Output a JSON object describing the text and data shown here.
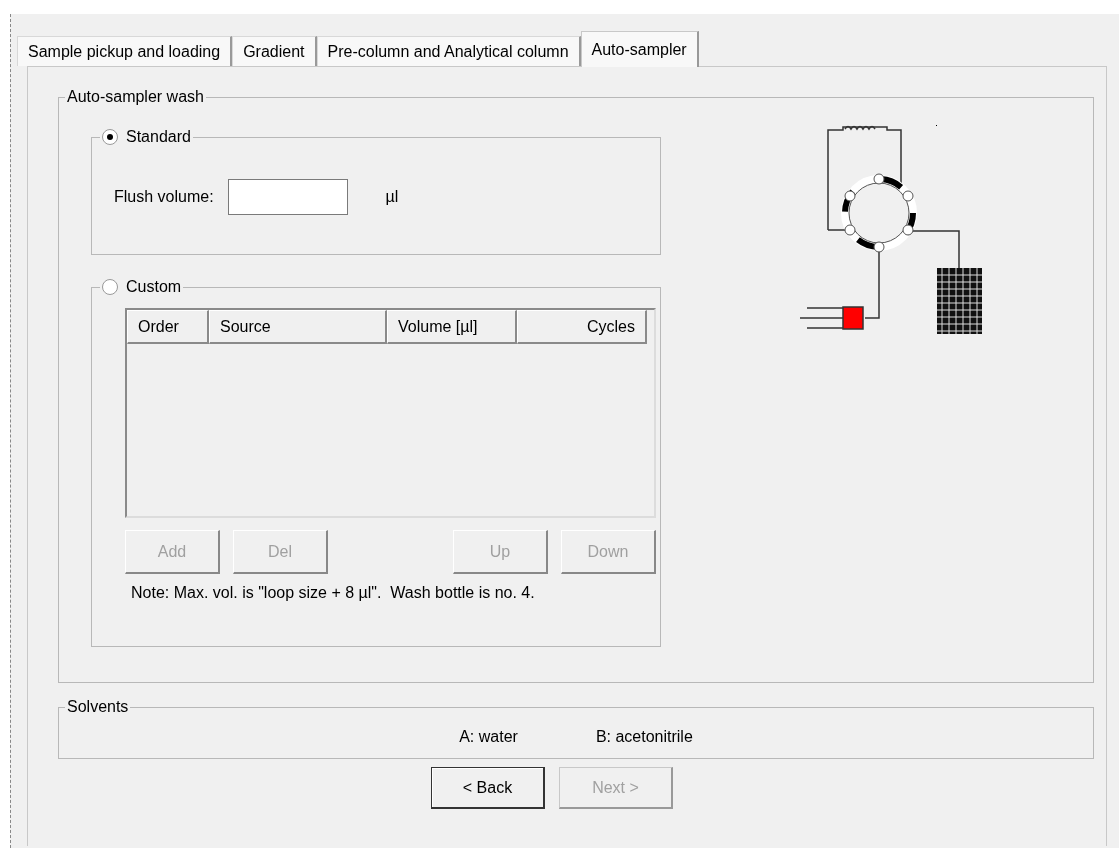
{
  "tabs": [
    {
      "label": "Sample pickup and loading",
      "selected": false
    },
    {
      "label": "Gradient",
      "selected": false
    },
    {
      "label": "Pre-column and Analytical column",
      "selected": false
    },
    {
      "label": "Auto-sampler",
      "selected": true
    }
  ],
  "wash": {
    "title": "Auto-sampler wash",
    "modes": [
      {
        "label": "Standard",
        "selected": true
      },
      {
        "label": "Custom",
        "selected": false
      }
    ],
    "flush_label": "Flush volume:",
    "flush_unit": "µl",
    "columns": [
      "Order",
      "Source",
      "Volume [µl]",
      "Cycles"
    ],
    "list_buttons": [
      {
        "label": "Add",
        "disabled": true
      },
      {
        "label": "Del",
        "disabled": true
      },
      {
        "label": "Up",
        "disabled": true
      },
      {
        "label": "Down",
        "disabled": true
      }
    ],
    "note": "Note: Max. vol. is \"loop size + 8 µl\".  Wash bottle is no. 4."
  },
  "solvents": {
    "title": "Solvents",
    "items": [
      "A: water",
      "B: acetonitrile"
    ]
  },
  "buttons": [
    {
      "label": "< Back",
      "disabled": false
    },
    {
      "label": "Next >",
      "disabled": true
    }
  ]
}
